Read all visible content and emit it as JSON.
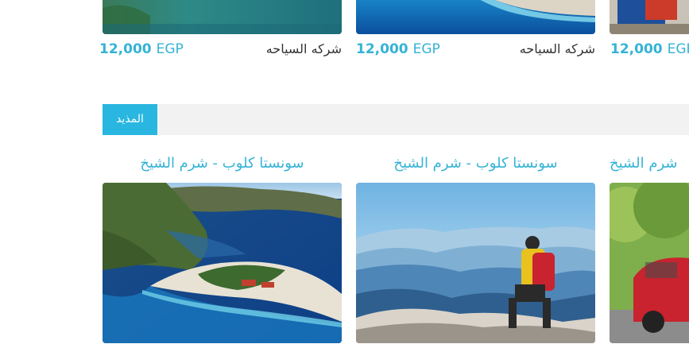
{
  "top_row": {
    "cards": [
      {
        "price": "12,000",
        "currency": "EGP",
        "company": "شركه السياحه"
      },
      {
        "price": "12,000",
        "currency": "EGP",
        "company": "شركه السياحه"
      },
      {
        "price": "12,000",
        "currency": "EGP"
      }
    ]
  },
  "more_section": {
    "button_label": "المذيد"
  },
  "bottom_row": {
    "cards": [
      {
        "title": "سونستا كلوب - شرم الشيخ",
        "image": "lagoon-beach"
      },
      {
        "title": "سونستا كلوب - شرم الشيخ",
        "image": "hiker-mountains"
      },
      {
        "title": "شرم الشيخ",
        "image": "red-car"
      }
    ]
  },
  "colors": {
    "accent": "#29b6e0",
    "price_text": "#35b3d6",
    "bar_bg": "#f2f2f2"
  }
}
